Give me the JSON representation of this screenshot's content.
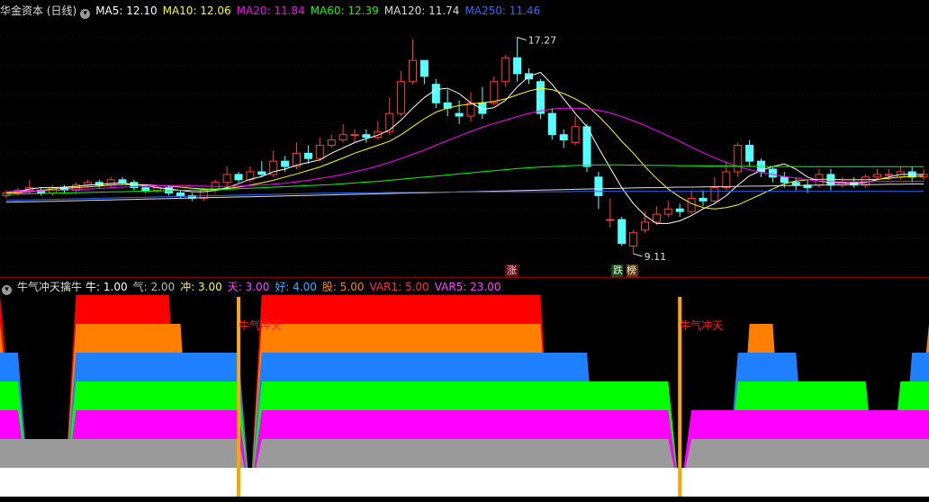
{
  "main": {
    "title": "华金资本 (日线)",
    "ma": [
      {
        "label": "MA5: 12.10",
        "color": "#ffffff"
      },
      {
        "label": "MA10: 12.06",
        "color": "#ffff00"
      },
      {
        "label": "MA20: 11.84",
        "color": "#ff00ff"
      },
      {
        "label": "MA60: 12.39",
        "color": "#00ff00"
      },
      {
        "label": "MA120: 11.74",
        "color": "#dcdcdc"
      },
      {
        "label": "MA250: 11.46",
        "color": "#3366ff"
      }
    ],
    "high_label": "17.27",
    "low_label": "9.11",
    "tag_up": "涨",
    "tag_down_1": "跌",
    "tag_down_2": "榜"
  },
  "sub": {
    "title": "牛气冲天擒牛",
    "values": [
      {
        "label": "牛: 1.00",
        "color": "#ffffff"
      },
      {
        "label": "气: 2.00",
        "color": "#bbbbbb"
      },
      {
        "label": "冲: 3.00",
        "color": "#ffff00"
      },
      {
        "label": "天: 3.00",
        "color": "#ff44ff"
      },
      {
        "label": "好: 4.00",
        "color": "#44aaff"
      },
      {
        "label": "股: 5.00",
        "color": "#ff8800"
      },
      {
        "label": "VAR1: 5.00",
        "color": "#ff3333"
      },
      {
        "label": "VAR5: 23.00",
        "color": "#ff44ff"
      }
    ],
    "signal_label": "牛气冲天",
    "level_colors": [
      "#ffffff",
      "#9a9a9a",
      "#ff00ff",
      "#00ff00",
      "#1e7fff",
      "#ff8000",
      "#ff0000"
    ]
  },
  "chart_data": {
    "type": "candlestick",
    "ylim": [
      8.5,
      18.0
    ],
    "candles": [
      [
        11.3,
        11.4,
        11.2,
        11.5
      ],
      [
        11.4,
        11.5,
        11.3,
        11.6
      ],
      [
        11.5,
        11.6,
        11.4,
        11.9
      ],
      [
        11.5,
        11.4,
        11.3,
        11.6
      ],
      [
        11.4,
        11.6,
        11.3,
        11.7
      ],
      [
        11.6,
        11.5,
        11.4,
        11.7
      ],
      [
        11.5,
        11.7,
        11.4,
        11.8
      ],
      [
        11.7,
        11.8,
        11.6,
        11.9
      ],
      [
        11.8,
        11.7,
        11.6,
        11.9
      ],
      [
        11.7,
        11.9,
        11.6,
        12.0
      ],
      [
        11.9,
        11.8,
        11.7,
        12.0
      ],
      [
        11.8,
        11.6,
        11.5,
        11.9
      ],
      [
        11.6,
        11.5,
        11.4,
        11.7
      ],
      [
        11.5,
        11.6,
        11.4,
        11.7
      ],
      [
        11.6,
        11.4,
        11.3,
        11.7
      ],
      [
        11.4,
        11.3,
        11.2,
        11.5
      ],
      [
        11.3,
        11.2,
        11.1,
        11.4
      ],
      [
        11.2,
        11.5,
        11.1,
        11.6
      ],
      [
        11.5,
        11.8,
        11.4,
        11.9
      ],
      [
        11.8,
        12.1,
        11.6,
        12.4
      ],
      [
        12.1,
        11.9,
        11.8,
        12.2
      ],
      [
        11.9,
        12.2,
        11.8,
        12.4
      ],
      [
        12.2,
        12.1,
        12.0,
        12.6
      ],
      [
        12.1,
        12.6,
        12.0,
        13.0
      ],
      [
        12.6,
        12.4,
        12.2,
        12.8
      ],
      [
        12.4,
        12.9,
        12.3,
        13.3
      ],
      [
        12.9,
        12.7,
        12.5,
        13.2
      ],
      [
        12.7,
        13.2,
        12.6,
        13.5
      ],
      [
        13.2,
        13.4,
        13.1,
        13.6
      ],
      [
        13.4,
        13.6,
        13.3,
        14.0
      ],
      [
        13.6,
        13.6,
        13.3,
        13.8
      ],
      [
        13.6,
        13.5,
        13.3,
        13.8
      ],
      [
        13.5,
        13.7,
        13.4,
        14.1
      ],
      [
        13.7,
        14.4,
        13.6,
        15.0
      ],
      [
        14.4,
        15.6,
        14.3,
        16.0
      ],
      [
        15.6,
        16.4,
        15.5,
        17.2
      ],
      [
        16.4,
        15.8,
        15.5,
        16.3
      ],
      [
        15.5,
        14.8,
        14.6,
        15.7
      ],
      [
        14.8,
        14.6,
        14.3,
        15.3
      ],
      [
        14.4,
        14.3,
        14.0,
        14.9
      ],
      [
        14.3,
        14.8,
        14.1,
        15.2
      ],
      [
        14.8,
        14.4,
        14.2,
        15.4
      ],
      [
        14.8,
        15.6,
        14.7,
        15.8
      ],
      [
        15.6,
        16.5,
        15.4,
        16.6
      ],
      [
        16.5,
        15.9,
        15.6,
        17.27
      ],
      [
        15.9,
        15.7,
        15.5,
        16.1
      ],
      [
        15.6,
        14.4,
        14.2,
        15.7
      ],
      [
        14.4,
        13.6,
        13.4,
        14.6
      ],
      [
        13.6,
        13.4,
        13.1,
        13.8
      ],
      [
        13.3,
        13.9,
        13.2,
        14.3
      ],
      [
        13.9,
        12.4,
        12.2,
        14.0
      ],
      [
        12.0,
        11.3,
        10.8,
        12.2
      ],
      [
        10.4,
        10.4,
        10.1,
        11.2
      ],
      [
        10.4,
        9.5,
        9.4,
        10.5
      ],
      [
        9.4,
        9.9,
        9.11,
        10.0
      ],
      [
        10.0,
        10.3,
        9.9,
        10.7
      ],
      [
        10.3,
        10.6,
        10.2,
        10.9
      ],
      [
        10.6,
        10.8,
        10.5,
        11.1
      ],
      [
        10.8,
        10.7,
        10.5,
        11.0
      ],
      [
        10.7,
        11.2,
        10.6,
        11.5
      ],
      [
        11.2,
        11.1,
        10.9,
        11.5
      ],
      [
        11.1,
        11.6,
        11.0,
        12.0
      ],
      [
        11.6,
        12.2,
        11.5,
        12.6
      ],
      [
        12.2,
        13.2,
        12.0,
        13.3
      ],
      [
        13.2,
        12.6,
        12.4,
        13.4
      ],
      [
        12.6,
        12.2,
        12.0,
        12.7
      ],
      [
        12.3,
        12.0,
        11.8,
        12.4
      ],
      [
        12.0,
        11.8,
        11.6,
        12.2
      ],
      [
        11.8,
        11.7,
        11.5,
        12.0
      ],
      [
        11.7,
        11.6,
        11.4,
        11.9
      ],
      [
        11.7,
        12.1,
        11.6,
        12.3
      ],
      [
        12.1,
        11.7,
        11.5,
        12.3
      ],
      [
        11.7,
        11.8,
        11.6,
        12.0
      ],
      [
        11.8,
        11.7,
        11.6,
        12.0
      ],
      [
        11.7,
        12.0,
        11.6,
        12.1
      ],
      [
        12.0,
        12.1,
        11.9,
        12.3
      ],
      [
        12.1,
        12.1,
        11.9,
        12.3
      ],
      [
        12.0,
        12.2,
        11.9,
        12.4
      ],
      [
        12.2,
        12.0,
        11.8,
        12.4
      ],
      [
        12.0,
        12.1,
        11.9,
        12.3
      ]
    ],
    "ma_series": [
      {
        "name": "MA5",
        "color": "#ffffff",
        "values": [
          11.4,
          11.45,
          11.55,
          11.6,
          11.6,
          11.62,
          11.65,
          11.7,
          11.72,
          11.76,
          11.78,
          11.72,
          11.68,
          11.6,
          11.55,
          11.5,
          11.45,
          11.45,
          11.5,
          11.6,
          11.75,
          11.92,
          12.02,
          12.2,
          12.3,
          12.45,
          12.55,
          12.65,
          12.9,
          13.1,
          13.3,
          13.45,
          13.58,
          13.78,
          14.15,
          14.6,
          15.0,
          15.3,
          15.35,
          15.15,
          14.8,
          14.55,
          14.62,
          14.9,
          15.4,
          15.8,
          15.95,
          15.5,
          14.95,
          14.4,
          13.9,
          13.1,
          12.35,
          11.6,
          11.0,
          10.55,
          10.25,
          10.25,
          10.35,
          10.55,
          10.8,
          11.0,
          11.3,
          11.7,
          12.05,
          12.25,
          12.4,
          12.5,
          12.3,
          12.0,
          11.85,
          11.8,
          11.78,
          11.76,
          11.8,
          11.9,
          12.0,
          12.1,
          12.1,
          12.1
        ]
      },
      {
        "name": "MA10",
        "color": "#ffff00",
        "values": [
          11.4,
          11.42,
          11.45,
          11.5,
          11.55,
          11.57,
          11.6,
          11.63,
          11.66,
          11.7,
          11.72,
          11.72,
          11.71,
          11.68,
          11.66,
          11.62,
          11.58,
          11.55,
          11.55,
          11.57,
          11.62,
          11.7,
          11.78,
          11.88,
          12.0,
          12.12,
          12.25,
          12.38,
          12.55,
          12.72,
          12.9,
          13.05,
          13.2,
          13.35,
          13.6,
          13.9,
          14.2,
          14.45,
          14.6,
          14.7,
          14.75,
          14.8,
          14.85,
          14.95,
          15.1,
          15.25,
          15.35,
          15.3,
          15.15,
          14.95,
          14.7,
          14.3,
          13.85,
          13.35,
          12.9,
          12.4,
          11.95,
          11.55,
          11.25,
          11.0,
          10.85,
          10.8,
          10.85,
          10.95,
          11.15,
          11.35,
          11.55,
          11.75,
          11.85,
          11.9,
          11.92,
          11.92,
          11.9,
          11.9,
          11.9,
          11.92,
          11.95,
          12.0,
          12.02,
          12.04
        ]
      },
      {
        "name": "MA20",
        "color": "#ff00ff",
        "values": [
          11.45,
          11.46,
          11.47,
          11.48,
          11.5,
          11.51,
          11.53,
          11.55,
          11.57,
          11.6,
          11.62,
          11.64,
          11.66,
          11.67,
          11.68,
          11.68,
          11.67,
          11.66,
          11.65,
          11.65,
          11.66,
          11.68,
          11.7,
          11.73,
          11.77,
          11.82,
          11.88,
          11.95,
          12.02,
          12.1,
          12.2,
          12.3,
          12.42,
          12.55,
          12.7,
          12.86,
          13.02,
          13.2,
          13.38,
          13.55,
          13.72,
          13.88,
          14.02,
          14.15,
          14.28,
          14.4,
          14.5,
          14.57,
          14.6,
          14.6,
          14.58,
          14.52,
          14.42,
          14.28,
          14.12,
          13.95,
          13.75,
          13.55,
          13.35,
          13.12,
          12.92,
          12.72,
          12.55,
          12.4,
          12.28,
          12.18,
          12.1,
          12.02,
          11.96,
          11.9,
          11.86,
          11.83,
          11.82,
          11.82,
          11.83,
          11.84,
          11.84,
          11.84,
          11.84,
          11.84
        ]
      },
      {
        "name": "MA60",
        "color": "#00ff00",
        "values": [
          11.35,
          11.36,
          11.37,
          11.38,
          11.39,
          11.4,
          11.41,
          11.42,
          11.43,
          11.44,
          11.45,
          11.46,
          11.47,
          11.48,
          11.49,
          11.5,
          11.51,
          11.52,
          11.53,
          11.54,
          11.56,
          11.58,
          11.6,
          11.62,
          11.64,
          11.66,
          11.68,
          11.7,
          11.72,
          11.75,
          11.78,
          11.81,
          11.84,
          11.88,
          11.92,
          11.96,
          12.0,
          12.04,
          12.08,
          12.12,
          12.16,
          12.2,
          12.24,
          12.28,
          12.32,
          12.35,
          12.38,
          12.4,
          12.42,
          12.44,
          12.45,
          12.46,
          12.46,
          12.46,
          12.45,
          12.45,
          12.44,
          12.44,
          12.43,
          12.43,
          12.42,
          12.42,
          12.42,
          12.41,
          12.41,
          12.4,
          12.4,
          12.4,
          12.4,
          12.39,
          12.39,
          12.39,
          12.39,
          12.39,
          12.39,
          12.39,
          12.39,
          12.39,
          12.39,
          12.39
        ]
      },
      {
        "name": "MA120",
        "color": "#dcdcdc",
        "values": [
          11.05,
          11.06,
          11.07,
          11.08,
          11.09,
          11.1,
          11.11,
          11.12,
          11.13,
          11.14,
          11.15,
          11.16,
          11.17,
          11.18,
          11.19,
          11.2,
          11.21,
          11.22,
          11.23,
          11.24,
          11.25,
          11.26,
          11.27,
          11.28,
          11.29,
          11.3,
          11.31,
          11.32,
          11.33,
          11.34,
          11.35,
          11.36,
          11.37,
          11.38,
          11.39,
          11.4,
          11.41,
          11.42,
          11.43,
          11.44,
          11.45,
          11.46,
          11.47,
          11.48,
          11.49,
          11.5,
          11.51,
          11.52,
          11.53,
          11.54,
          11.55,
          11.56,
          11.57,
          11.58,
          11.59,
          11.6,
          11.6,
          11.61,
          11.62,
          11.62,
          11.63,
          11.64,
          11.64,
          11.65,
          11.66,
          11.66,
          11.67,
          11.68,
          11.68,
          11.69,
          11.7,
          11.7,
          11.71,
          11.71,
          11.72,
          11.72,
          11.73,
          11.73,
          11.74,
          11.74
        ]
      },
      {
        "name": "MA250",
        "color": "#3366ff",
        "values": [
          11.12,
          11.13,
          11.14,
          11.15,
          11.16,
          11.17,
          11.18,
          11.19,
          11.2,
          11.21,
          11.22,
          11.23,
          11.24,
          11.25,
          11.26,
          11.27,
          11.28,
          11.29,
          11.3,
          11.31,
          11.32,
          11.33,
          11.34,
          11.35,
          11.36,
          11.37,
          11.38,
          11.39,
          11.39,
          11.4,
          11.4,
          11.41,
          11.41,
          11.42,
          11.42,
          11.42,
          11.43,
          11.43,
          11.43,
          11.44,
          11.44,
          11.44,
          11.44,
          11.45,
          11.45,
          11.45,
          11.45,
          11.45,
          11.45,
          11.46,
          11.46,
          11.46,
          11.46,
          11.46,
          11.46,
          11.46,
          11.46,
          11.46,
          11.46,
          11.46,
          11.46,
          11.46,
          11.46,
          11.46,
          11.46,
          11.46,
          11.46,
          11.46,
          11.46,
          11.46,
          11.46,
          11.46,
          11.46,
          11.46,
          11.46,
          11.46,
          11.46,
          11.46,
          11.46,
          11.46
        ]
      }
    ],
    "sub_levels": [
      6,
      4,
      1,
      1,
      1,
      1,
      6,
      6,
      6,
      6,
      6,
      6,
      6,
      6,
      6,
      5,
      4,
      4,
      4,
      4,
      4,
      0,
      6,
      6,
      6,
      6,
      6,
      6,
      6,
      6,
      6,
      6,
      6,
      6,
      6,
      6,
      6,
      6,
      6,
      6,
      6,
      6,
      6,
      6,
      6,
      6,
      6,
      4,
      4,
      4,
      4,
      3,
      3,
      3,
      3,
      3,
      3,
      3,
      0,
      2,
      2,
      2,
      2,
      4,
      5,
      5,
      5,
      4,
      4,
      3,
      3,
      3,
      3,
      3,
      3,
      2,
      2,
      3,
      4,
      5
    ],
    "signal_index": [
      20,
      58
    ]
  }
}
